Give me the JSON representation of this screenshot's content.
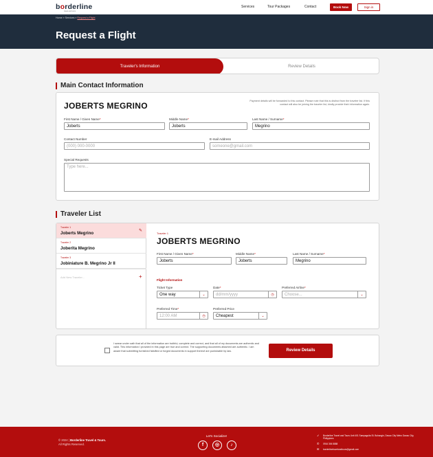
{
  "nav": {
    "logo_text_b": "b",
    "logo_text_o": "o",
    "logo_text_rest": "rderline",
    "logo_sub": "travel and tours",
    "links": [
      "Services",
      "Tour Packages",
      "Contact"
    ],
    "book_now": "Book Now",
    "sign_in": "Sign in"
  },
  "hero": {
    "breadcrumb": [
      "Home",
      "Services",
      "Request a Flight"
    ],
    "separator": "»",
    "title": "Request a Flight"
  },
  "steps": {
    "active": "Traveler's Information",
    "inactive": "Review Details"
  },
  "main_contact": {
    "section_title": "Main Contact Information",
    "name": "JOBERTS MEGRINO",
    "note": "Payment details will be forwarded to this contact. Please note that this is distinct from the traveler list. If this contact will also be joining the traveler list, kindly provide their information again.",
    "first_name_label": "First Name / Given Name",
    "first_name_value": "Joberts",
    "middle_name_label": "Middle Name",
    "middle_name_value": "Joberts",
    "last_name_label": "Last Name / Surname",
    "last_name_value": "Megrino",
    "contact_label": "Contact Number",
    "contact_placeholder": "(000) 000-0000",
    "email_label": "E-mail Address",
    "email_placeholder": "someone@gmail.com",
    "requests_label": "Special Requests",
    "requests_placeholder": "Type here...",
    "required_mark": "*"
  },
  "traveler_list": {
    "section_title": "Traveler List",
    "items": [
      {
        "tag": "Traveler 1",
        "name": "Joberts Megrino"
      },
      {
        "tag": "Traveler 2",
        "name": "Joberita Megrino"
      },
      {
        "tag": "Traveler 3",
        "name": "Jobiniature B. Megrino Jr II"
      }
    ],
    "add_placeholder": "Add New Traveler...",
    "add_icon": "+",
    "edit_icon": "✎"
  },
  "traveler_detail": {
    "tag": "Traveler 1",
    "name": "JOBERTS MEGRINO",
    "first_name_label": "First Name / Given Name",
    "first_name_value": "Joberts",
    "middle_name_label": "Middle Name",
    "middle_name_value": "Joberts",
    "last_name_label": "Last Name / Surname",
    "last_name_value": "Megrino",
    "flight_info_title": "Flight Information",
    "ticket_type_label": "Ticket Type",
    "ticket_type_value": "One way",
    "date_label": "Date",
    "date_placeholder": "dd/mm/yyyy",
    "airline_label": "Preferred Airline",
    "airline_placeholder": "Choose...",
    "time_label": "Preferred Time",
    "time_placeholder": "12:00 AM",
    "price_label": "Preferred Price",
    "price_value": "Cheapest"
  },
  "declaration": {
    "text": "I swear under oath that all of the information are truthful, complete and correct, and that all of my documents are authentic and valid. This information I provided in this page are true and correct. The supporting documents attached are authentic. I am aware that submitting furnished falsified or forged documents in support thereof are punishable by law.",
    "button": "Review Details"
  },
  "footer": {
    "copyright_prefix": "© 2024 |",
    "company": "Borderline Travel & Tours.",
    "rights": "All Rights Reserved.",
    "social_title": "Let's Socialize!",
    "social": [
      "f",
      "◎",
      "♪"
    ],
    "address": "Borderline Travel and Tours Unit 401 Sampaguita St. Buhangin, Davao City Metro Davao City, Philippines",
    "phone": "0916 306 8888",
    "email": "borderlinetravelandtours@gmail.com"
  },
  "colors": {
    "brand_red": "#b30d0d",
    "hero_navy": "#1f2d3d"
  }
}
